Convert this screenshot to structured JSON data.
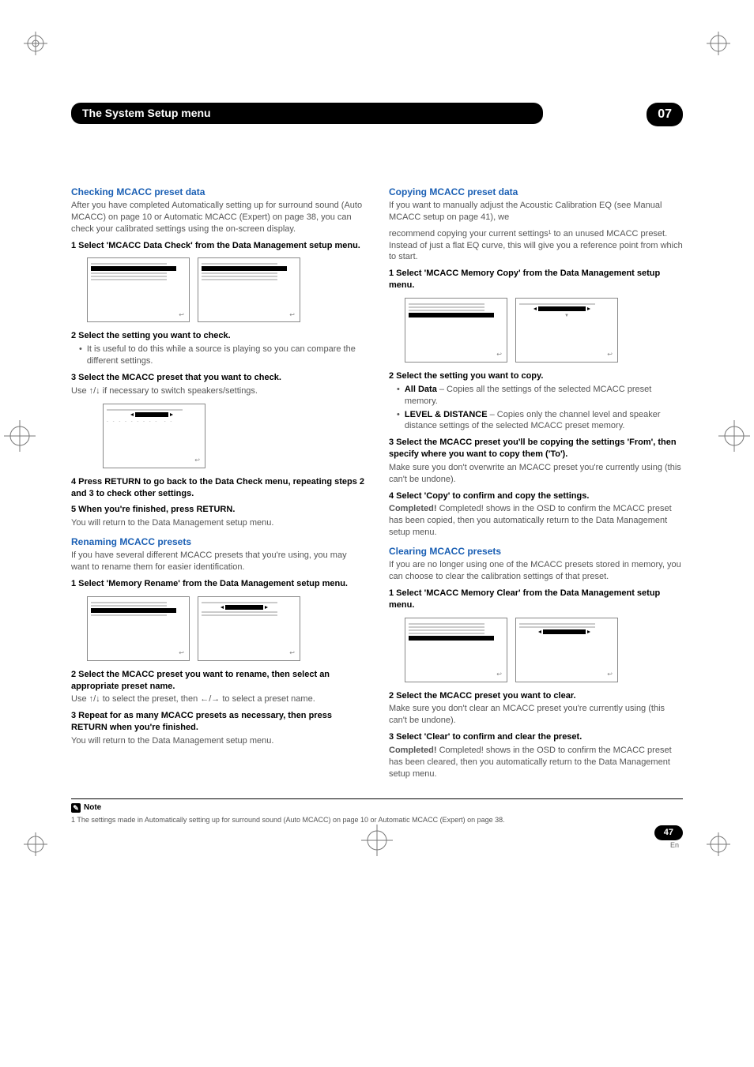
{
  "chapter": "07",
  "header_title": "The System Setup menu",
  "left": {
    "s1_head": "Checking MCACC preset data",
    "s1_body": "After you have completed Automatically setting up for surround sound (Auto MCACC) on page 10 or Automatic MCACC (Expert) on page 38, you can check your calibrated settings using the on-screen display.",
    "s1_step1": "1  Select 'MCACC Data Check' from the Data Management setup menu.",
    "s1_step2": "2  Select the setting you want to check.",
    "s1_step2_bullet": "It is useful to do this while a source is playing so you can compare the different settings.",
    "s1_step3": "3  Select the MCACC preset that you want to check.",
    "s1_step3_body": "Use ↑/↓ if necessary to switch speakers/settings.",
    "s1_step4": "4  Press RETURN to go back to the Data Check menu, repeating steps 2 and 3 to check other settings.",
    "s1_step5": "5  When you're finished, press RETURN.",
    "s1_step5_body": "You will return to the Data Management setup menu.",
    "s2_head": "Renaming MCACC presets",
    "s2_body": "If you have several different MCACC presets that you're using, you may want to rename them for easier identification.",
    "s2_step1": "1  Select 'Memory Rename' from the Data Management setup menu.",
    "s2_step2": "2  Select the MCACC preset you want to rename, then select an appropriate preset name.",
    "s2_step2_body": "Use ↑/↓ to select the preset, then ←/→ to select a preset name.",
    "s2_step3": "3  Repeat for as many MCACC presets as necessary, then press RETURN when you're finished.",
    "s2_step3_body": "You will return to the Data Management setup menu."
  },
  "right": {
    "s1_head": "Copying MCACC preset data",
    "s1_body_a": "If you want to manually adjust the Acoustic Calibration EQ (see Manual MCACC setup on page 41), we",
    "s1_body_b": "recommend copying your current settings¹ to an unused MCACC preset. Instead of just a flat EQ curve, this will give you a reference point from which to start.",
    "s1_step1": "1  Select 'MCACC Memory Copy' from the Data Management setup menu.",
    "s1_step2": "2  Select the setting you want to copy.",
    "s1_b1_title": "All Data",
    "s1_b1_body": " – Copies all the settings of the selected MCACC preset memory.",
    "s1_b2_title": "LEVEL & DISTANCE",
    "s1_b2_body": " – Copies only the channel level and speaker distance settings of the selected MCACC preset memory.",
    "s1_step3": "3  Select the MCACC preset you'll be copying the settings 'From', then specify where you want to copy them ('To').",
    "s1_step3_body": "Make sure you don't overwrite an MCACC preset you're currently using (this can't be undone).",
    "s1_step4": "4  Select 'Copy' to confirm and copy the settings.",
    "s1_step4_body": "Completed! shows in the OSD to confirm the MCACC preset has been copied, then you automatically return to the Data Management setup menu.",
    "s2_head": "Clearing MCACC presets",
    "s2_body": "If you are no longer using one of the MCACC presets stored in memory, you can choose to clear the calibration settings of that preset.",
    "s2_step1": "1  Select 'MCACC Memory Clear' from the Data Management setup menu.",
    "s2_step2": "2  Select the MCACC preset you want to clear.",
    "s2_step2_body": "Make sure you don't clear an MCACC preset you're currently using (this can't be undone).",
    "s2_step3": "3  Select 'Clear' to confirm and clear the preset.",
    "s2_step3_body": "Completed! shows in the OSD to confirm the MCACC preset has been cleared, then you automatically return to the Data Management setup menu."
  },
  "note_label": "Note",
  "footnote": "1 The settings made in Automatically setting up for surround sound (Auto MCACC) on page 10 or Automatic MCACC (Expert) on page 38.",
  "page_number": "47",
  "page_lang": "En"
}
